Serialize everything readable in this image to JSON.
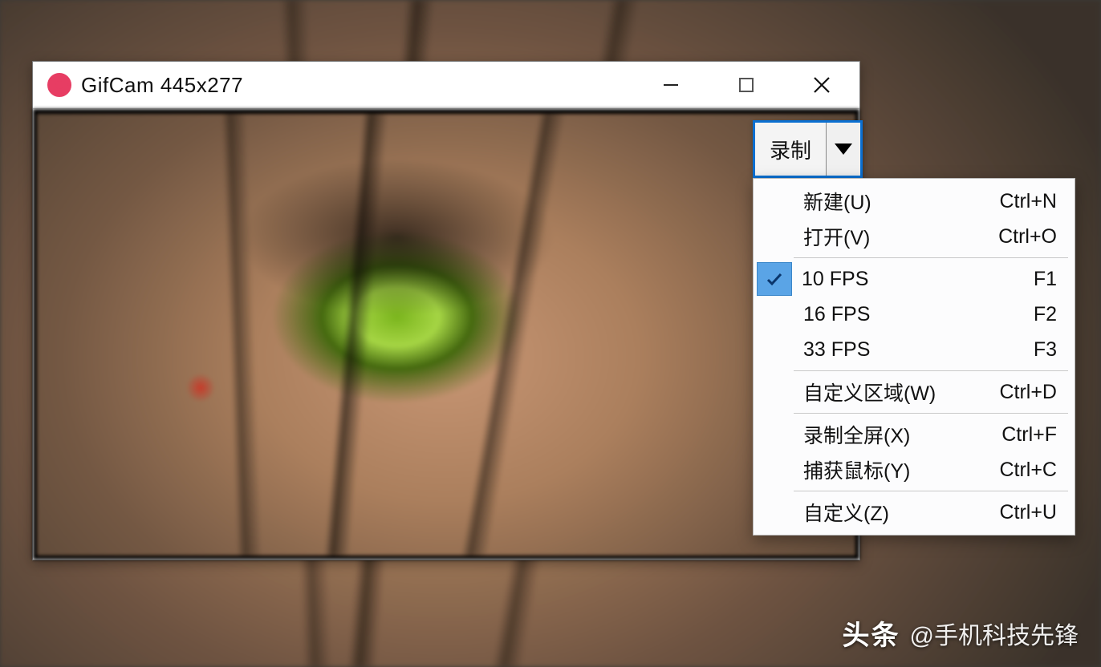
{
  "window": {
    "title": "GifCam 445x277"
  },
  "splitButton": {
    "label": "录制"
  },
  "menu": {
    "groups": [
      [
        {
          "label": "新建(U)",
          "shortcut": "Ctrl+N",
          "checked": false
        },
        {
          "label": "打开(V)",
          "shortcut": "Ctrl+O",
          "checked": false
        }
      ],
      [
        {
          "label": "10 FPS",
          "shortcut": "F1",
          "checked": true
        },
        {
          "label": "16 FPS",
          "shortcut": "F2",
          "checked": false
        },
        {
          "label": "33 FPS",
          "shortcut": "F3",
          "checked": false
        }
      ],
      [
        {
          "label": "自定义区域(W)",
          "shortcut": "Ctrl+D",
          "checked": false
        }
      ],
      [
        {
          "label": "录制全屏(X)",
          "shortcut": "Ctrl+F",
          "checked": false
        },
        {
          "label": "捕获鼠标(Y)",
          "shortcut": "Ctrl+C",
          "checked": false
        }
      ],
      [
        {
          "label": "自定义(Z)",
          "shortcut": "Ctrl+U",
          "checked": false
        }
      ]
    ]
  },
  "watermark": {
    "badge": "头条",
    "handle": "@手机科技先锋"
  }
}
